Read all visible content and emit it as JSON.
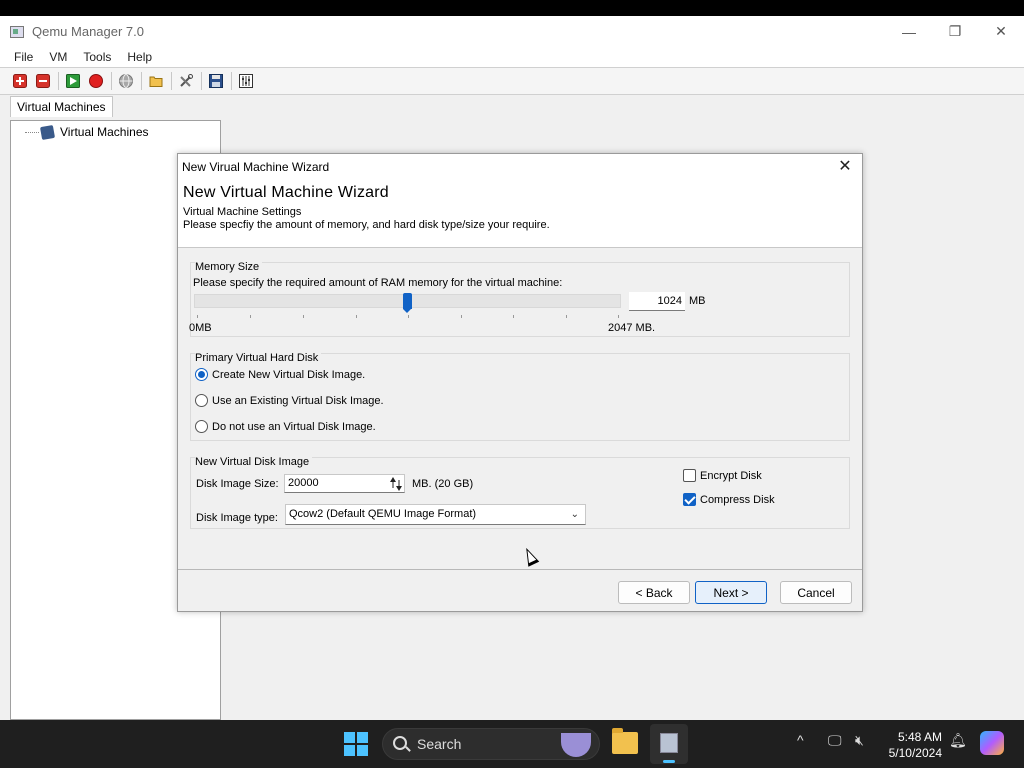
{
  "window": {
    "title": "Qemu Manager 7.0",
    "controls": {
      "minimize": "—",
      "restore": "❐",
      "close": "✕"
    }
  },
  "menu": [
    "File",
    "VM",
    "Tools",
    "Help"
  ],
  "toolbar": {
    "buttons": [
      "add-vm-icon",
      "remove-vm-icon",
      "start-vm-icon",
      "stop-vm-icon",
      "network-icon",
      "open-folder-icon",
      "tools-icon",
      "save-icon",
      "settings-icon"
    ],
    "colors": {
      "add": "#d6332b",
      "remove": "#d6332b",
      "start": "#2d9b3a",
      "stop": "#e02020"
    }
  },
  "tab": {
    "label": "Virtual Machines"
  },
  "tree": {
    "root_label": "Virtual Machines"
  },
  "dialog": {
    "window_title": "New Virual Machine Wizard",
    "close": "✕",
    "heading": "New Virtual Machine Wizard",
    "subtitle": "Virtual Machine Settings",
    "description": "Please specfiy the amount of memory, and hard disk type/size your require.",
    "memory": {
      "group_title": "Memory Size",
      "prompt": "Please specify the required amount of RAM memory for the virtual machine:",
      "value": "1024",
      "unit": "MB",
      "min_label": "0MB",
      "max_label": "2047 MB.",
      "slider_fraction": 0.5
    },
    "disk": {
      "group_title": "Primary Virtual Hard Disk",
      "options": [
        {
          "label": "Create New Virtual Disk Image.",
          "selected": true
        },
        {
          "label": "Use an  Existing Virtual Disk Image.",
          "selected": false
        },
        {
          "label": "Do not use an Virtual Disk Image.",
          "selected": false
        }
      ]
    },
    "new_disk": {
      "group_title": "New Virtual Disk Image",
      "size_label": "Disk Image Size:",
      "size_value": "20000",
      "size_unit": "MB. (20 GB)",
      "type_label": "Disk Image type:",
      "type_value": "Qcow2  (Default QEMU Image Format)",
      "encrypt_label": "Encrypt Disk",
      "encrypt_checked": false,
      "compress_label": "Compress Disk",
      "compress_checked": true
    },
    "buttons": {
      "back": "< Back",
      "next": "Next >",
      "cancel": "Cancel"
    }
  },
  "taskbar": {
    "search_label": "Search",
    "tray": {
      "chevron": "^",
      "network": "🖵",
      "volume": "🔇︎",
      "bell": "🔔︎"
    },
    "time": "5:48 AM",
    "date": "5/10/2024"
  }
}
